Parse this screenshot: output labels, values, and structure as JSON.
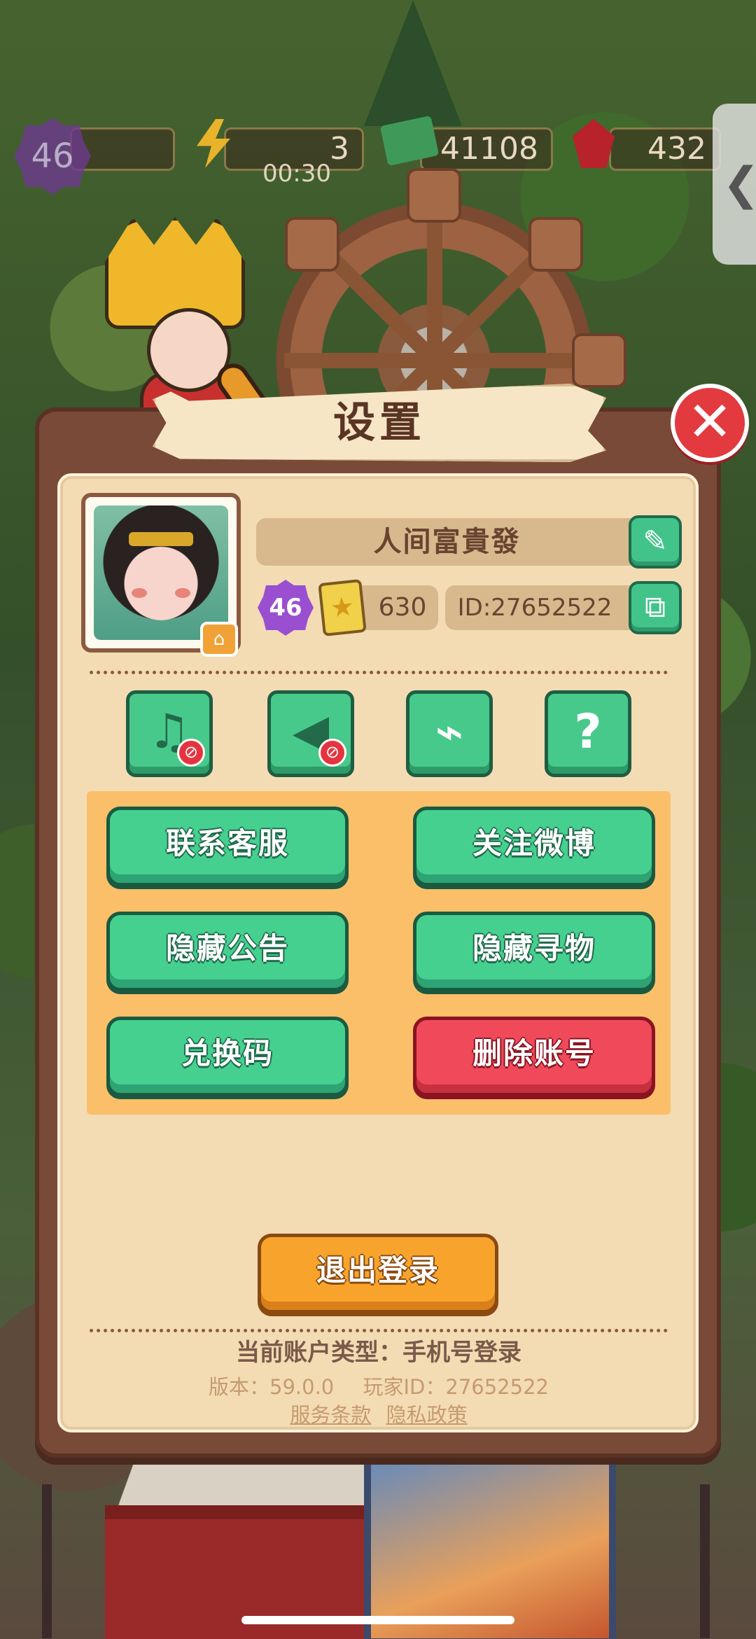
{
  "hud": {
    "level": "46",
    "energy": "3",
    "energy_timer": "00:30",
    "cash": "41108",
    "gems": "432",
    "side_tab_icon": "chevron-left-icon"
  },
  "dialog": {
    "title": "设置",
    "close_icon": "close-icon"
  },
  "profile": {
    "nickname": "人间富貴發",
    "level": "46",
    "cards": "630",
    "player_id_label": "ID:27652522",
    "edit_icon": "pencil-icon",
    "copy_icon": "copy-icon",
    "avatar_badge_icon": "hanger-icon"
  },
  "icon_buttons": [
    {
      "name": "music-toggle",
      "icon": "music-note-icon",
      "glyph": "♫",
      "disabled": true
    },
    {
      "name": "sound-toggle",
      "icon": "speaker-muted-icon",
      "glyph": "🔈",
      "disabled": true
    },
    {
      "name": "clear-cache",
      "icon": "broom-icon",
      "glyph": "🧹",
      "disabled": false
    },
    {
      "name": "help",
      "icon": "question-icon",
      "glyph": "?",
      "disabled": false
    }
  ],
  "buttons": {
    "contact_support": "联系客服",
    "follow_weibo": "关注微博",
    "hide_notice": "隐藏公告",
    "hide_search": "隐藏寻物",
    "redeem_code": "兑换码",
    "delete_account": "删除账号",
    "logout": "退出登录"
  },
  "footer": {
    "account_type": "当前账户类型：手机号登录",
    "version": "版本：59.0.0",
    "player_id": "玩家ID：27652522",
    "terms": "服务条款",
    "privacy": "隐私政策"
  },
  "colors": {
    "primary_green": "#45d08f",
    "danger_red": "#f04a5a",
    "logout_orange": "#f8a42c",
    "panel_orange": "#fbbf6a",
    "parchment": "#f3dcb3",
    "frame_brown": "#7a4a38"
  }
}
